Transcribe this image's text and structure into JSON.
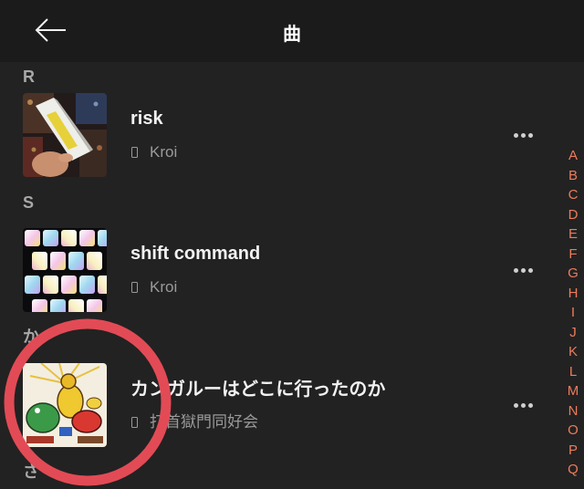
{
  "header": {
    "title": "曲",
    "back_icon": "arrow-left-icon"
  },
  "sections": [
    {
      "letter": "R",
      "song": {
        "title": "risk",
        "artist": "Kroi"
      }
    },
    {
      "letter": "S",
      "song": {
        "title": "shift command",
        "artist": "Kroi"
      }
    },
    {
      "letter": "か",
      "song": {
        "title": "カンガルーはどこに行ったのか",
        "artist": "打首獄門同好会"
      }
    },
    {
      "letter": "さ"
    }
  ],
  "icons": {
    "source": "device-icon",
    "more": "more-dots-icon"
  },
  "index": [
    "A",
    "B",
    "C",
    "D",
    "E",
    "F",
    "G",
    "H",
    "I",
    "J",
    "K",
    "L",
    "M",
    "N",
    "O",
    "P",
    "Q"
  ],
  "colors": {
    "background": "#222222",
    "header": "#1b1b1b",
    "text_primary": "#f2f2f2",
    "text_secondary": "#9a9a9a",
    "index_accent": "#ee7b5c",
    "highlight_circle": "#e24b55"
  }
}
